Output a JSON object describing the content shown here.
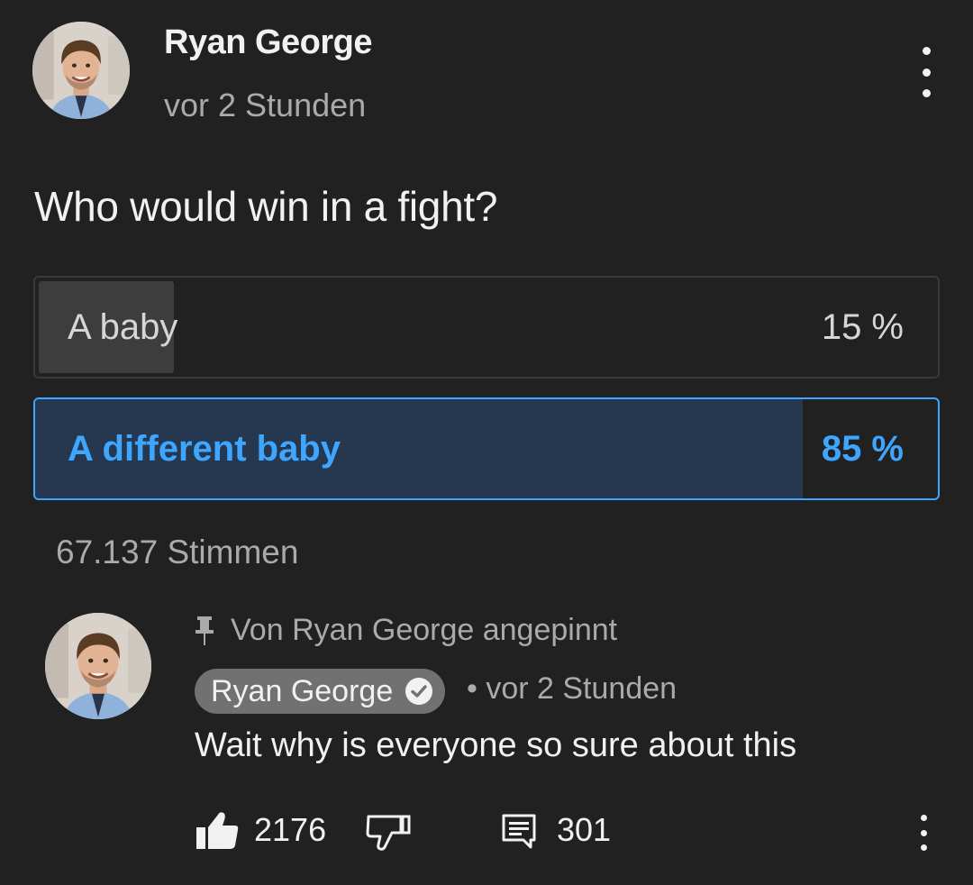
{
  "post": {
    "author": "Ryan George",
    "time": "vor 2 Stunden",
    "question": "Who would win in a fight?",
    "menu_icon": "more-vert-icon"
  },
  "poll": {
    "options": [
      {
        "label": "A baby",
        "percent_label": "15 %",
        "percent": 15,
        "selected": false
      },
      {
        "label": "A different baby",
        "percent_label": "85 %",
        "percent": 85,
        "selected": true
      }
    ],
    "votes": "67.137 Stimmen"
  },
  "comment": {
    "pinned_text": "Von Ryan George angepinnt",
    "author": "Ryan George",
    "time": "• vor 2 Stunden",
    "text": "Wait why is everyone so sure about this",
    "likes": "2176",
    "replies": "301"
  },
  "colors": {
    "background": "#212121",
    "accent": "#3ea6ff",
    "selected_fill": "#263850",
    "muted_text": "#aaaaaa",
    "chip": "#717171"
  }
}
